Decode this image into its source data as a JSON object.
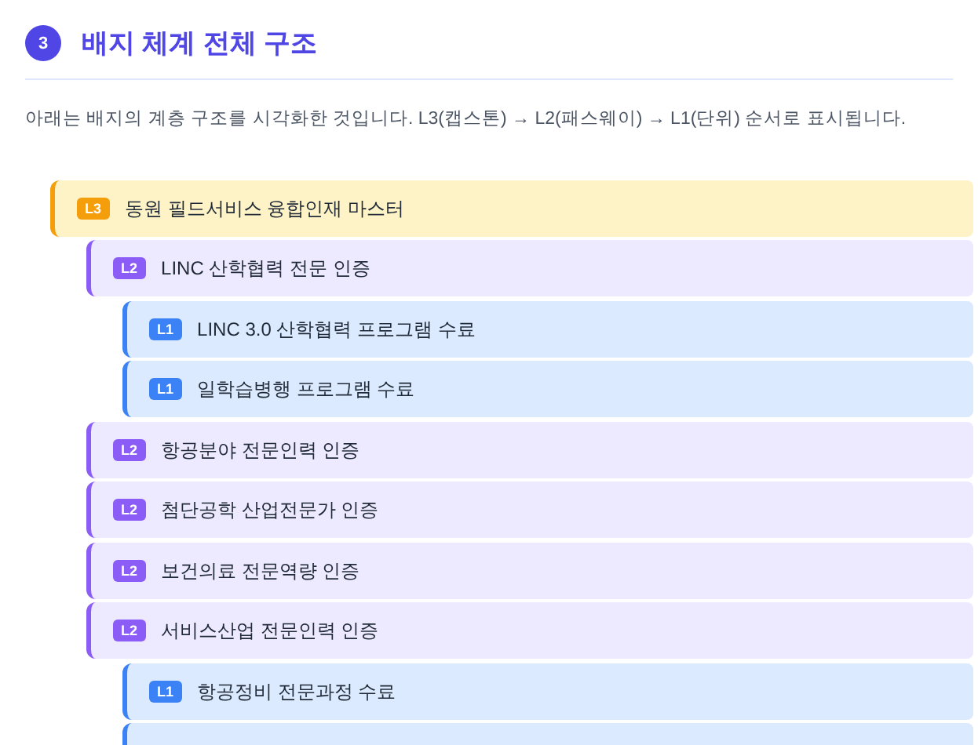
{
  "section": {
    "number": "3",
    "title": "배지 체계 전체 구조",
    "description": "아래는 배지의 계층 구조를 시각화한 것입니다. L3(캡스톤) → L2(패스웨이) → L1(단위) 순서로 표시됩니다."
  },
  "tree": [
    {
      "kind": "capstone",
      "badge": "L3",
      "name": "동원 필드서비스 융합인재 마스터",
      "children": [
        {
          "kind": "pathway",
          "badge": "L2",
          "name": "LINC 산학협력 전문 인증",
          "children": [
            {
              "kind": "unit",
              "badge": "L1",
              "name": "LINC 3.0 산학협력 프로그램 수료"
            },
            {
              "kind": "unit",
              "badge": "L1",
              "name": "일학습병행 프로그램 수료"
            }
          ]
        },
        {
          "kind": "pathway",
          "badge": "L2",
          "name": "항공분야 전문인력 인증"
        },
        {
          "kind": "pathway",
          "badge": "L2",
          "name": "첨단공학 산업전문가 인증"
        },
        {
          "kind": "pathway",
          "badge": "L2",
          "name": "보건의료 전문역량 인증"
        },
        {
          "kind": "pathway",
          "badge": "L2",
          "name": "서비스산업 전문인력 인증",
          "children": [
            {
              "kind": "unit",
              "badge": "L1",
              "name": "항공정비 전문과정 수료"
            },
            {
              "kind": "unit"
            }
          ]
        }
      ]
    }
  ]
}
